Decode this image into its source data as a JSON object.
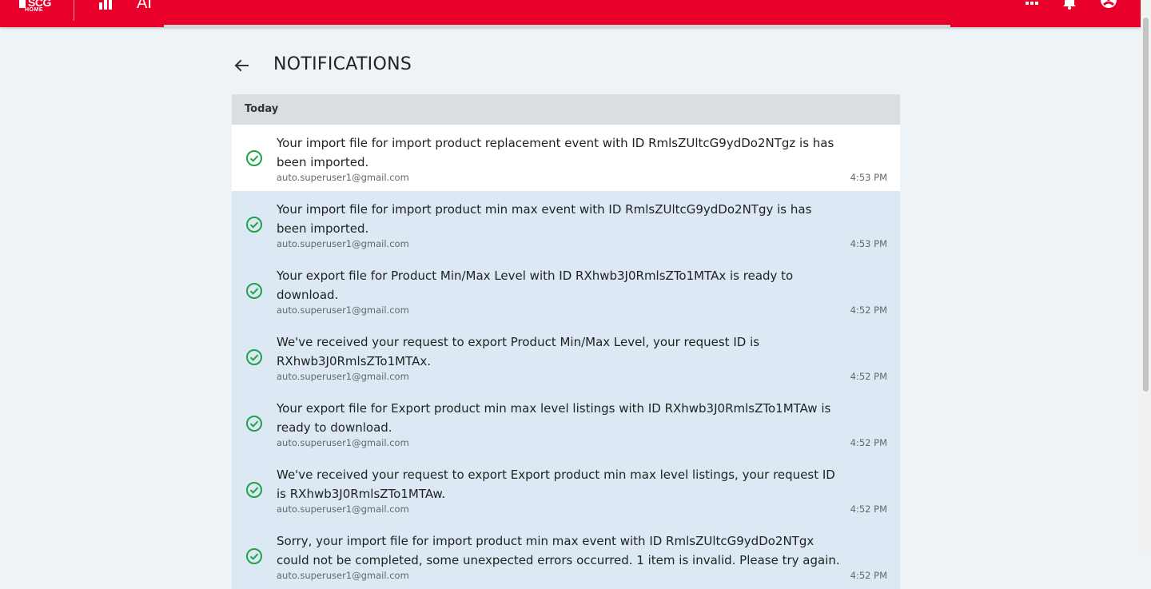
{
  "topbar": {
    "logo_text": "SCG",
    "logo_subtext": "HOME",
    "ai_label": "AI",
    "brand_color": "#e8002a"
  },
  "page": {
    "title": "NOTIFICATIONS"
  },
  "sections": [
    {
      "label": "Today",
      "items": [
        {
          "message": "Your import file for import product replacement event with ID RmlsZUltcG9ydDo2NTgz is has been imported.",
          "sender": "auto.superuser1@gmail.com",
          "time": "4:53 PM",
          "read": true,
          "status_icon": "check-circle-icon"
        },
        {
          "message": "Your import file for import product min max event with ID RmlsZUltcG9ydDo2NTgy is has been imported.",
          "sender": "auto.superuser1@gmail.com",
          "time": "4:53 PM",
          "read": false,
          "status_icon": "check-circle-icon"
        },
        {
          "message": "Your export file for Product Min/Max Level with ID RXhwb3J0RmlsZTo1MTAx is ready to download.",
          "sender": "auto.superuser1@gmail.com",
          "time": "4:52 PM",
          "read": false,
          "status_icon": "check-circle-icon"
        },
        {
          "message": "We've received your request to export Product Min/Max Level, your request ID is RXhwb3J0RmlsZTo1MTAx.",
          "sender": "auto.superuser1@gmail.com",
          "time": "4:52 PM",
          "read": false,
          "status_icon": "check-circle-icon"
        },
        {
          "message": "Your export file for Export product min max level listings with ID RXhwb3J0RmlsZTo1MTAw is ready to download.",
          "sender": "auto.superuser1@gmail.com",
          "time": "4:52 PM",
          "read": false,
          "status_icon": "check-circle-icon"
        },
        {
          "message": "We've received your request to export Export product min max level listings, your request ID is RXhwb3J0RmlsZTo1MTAw.",
          "sender": "auto.superuser1@gmail.com",
          "time": "4:52 PM",
          "read": false,
          "status_icon": "check-circle-icon"
        },
        {
          "message": "Sorry, your import file for import product min max event with ID RmlsZUltcG9ydDo2NTgx could not be completed, some unexpected errors occurred. 1 item is invalid. Please try again.",
          "sender": "auto.superuser1@gmail.com",
          "time": "4:52 PM",
          "read": false,
          "status_icon": "check-circle-icon"
        }
      ]
    }
  ],
  "colors": {
    "unread_bg": "#dce9f5",
    "read_bg": "#ffffff",
    "section_bg": "#d9dee3",
    "success_green": "#1fa34a"
  }
}
